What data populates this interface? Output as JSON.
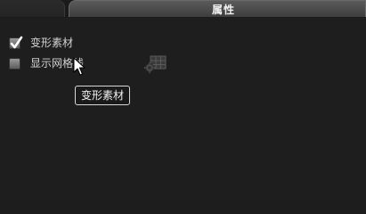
{
  "tabs": [
    {
      "label": ""
    },
    {
      "label": "属性",
      "active": true
    }
  ],
  "options": [
    {
      "label": "变形素材",
      "checked": true
    },
    {
      "label": "显示网格线",
      "checked": false
    }
  ],
  "tooltip": {
    "text": "变形素材"
  },
  "icons": {
    "checkmark": "checkmark-icon",
    "grid_settings": "grid-settings-icon",
    "cursor": "mouse-pointer-icon"
  },
  "colors": {
    "background": "#1e1e1e",
    "active_tab": "#4a4a4a",
    "text": "#d2d2d2"
  }
}
